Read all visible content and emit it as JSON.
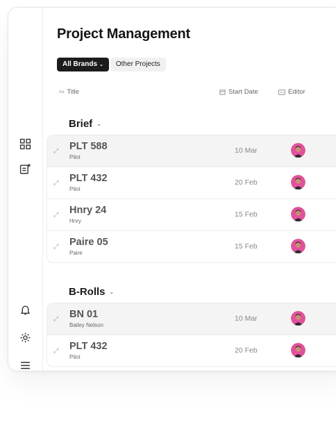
{
  "page": {
    "title": "Project Management"
  },
  "filters": [
    {
      "label": "All Brands",
      "active": true
    },
    {
      "label": "Other Projects",
      "active": false
    }
  ],
  "columns": {
    "title_prefix": "Aa",
    "title": "Title",
    "start_date": "Start Date",
    "editor": "Editor"
  },
  "sections": [
    {
      "title": "Brief",
      "rows": [
        {
          "name": "PLT 588",
          "sub": "Pilot",
          "date": "10 Mar"
        },
        {
          "name": "PLT 432",
          "sub": "Pilot",
          "date": "20 Feb"
        },
        {
          "name": "Hnry 24",
          "sub": "Hnry",
          "date": "15 Feb"
        },
        {
          "name": "Paire 05",
          "sub": "Paire",
          "date": "15 Feb"
        }
      ]
    },
    {
      "title": "B-Rolls",
      "rows": [
        {
          "name": "BN 01",
          "sub": "Bailey Nelson",
          "date": "10 Mar"
        },
        {
          "name": "PLT 432",
          "sub": "Pilot",
          "date": "20 Feb"
        }
      ]
    }
  ],
  "sidebar_icons": [
    "dashboard-icon",
    "projects-icon",
    "bell-icon",
    "gear-icon",
    "menu-icon"
  ],
  "colors": {
    "avatar_bg": "#e0529c",
    "chip_active": "#1c1c1c",
    "row_highlight": "#f4f4f5"
  }
}
